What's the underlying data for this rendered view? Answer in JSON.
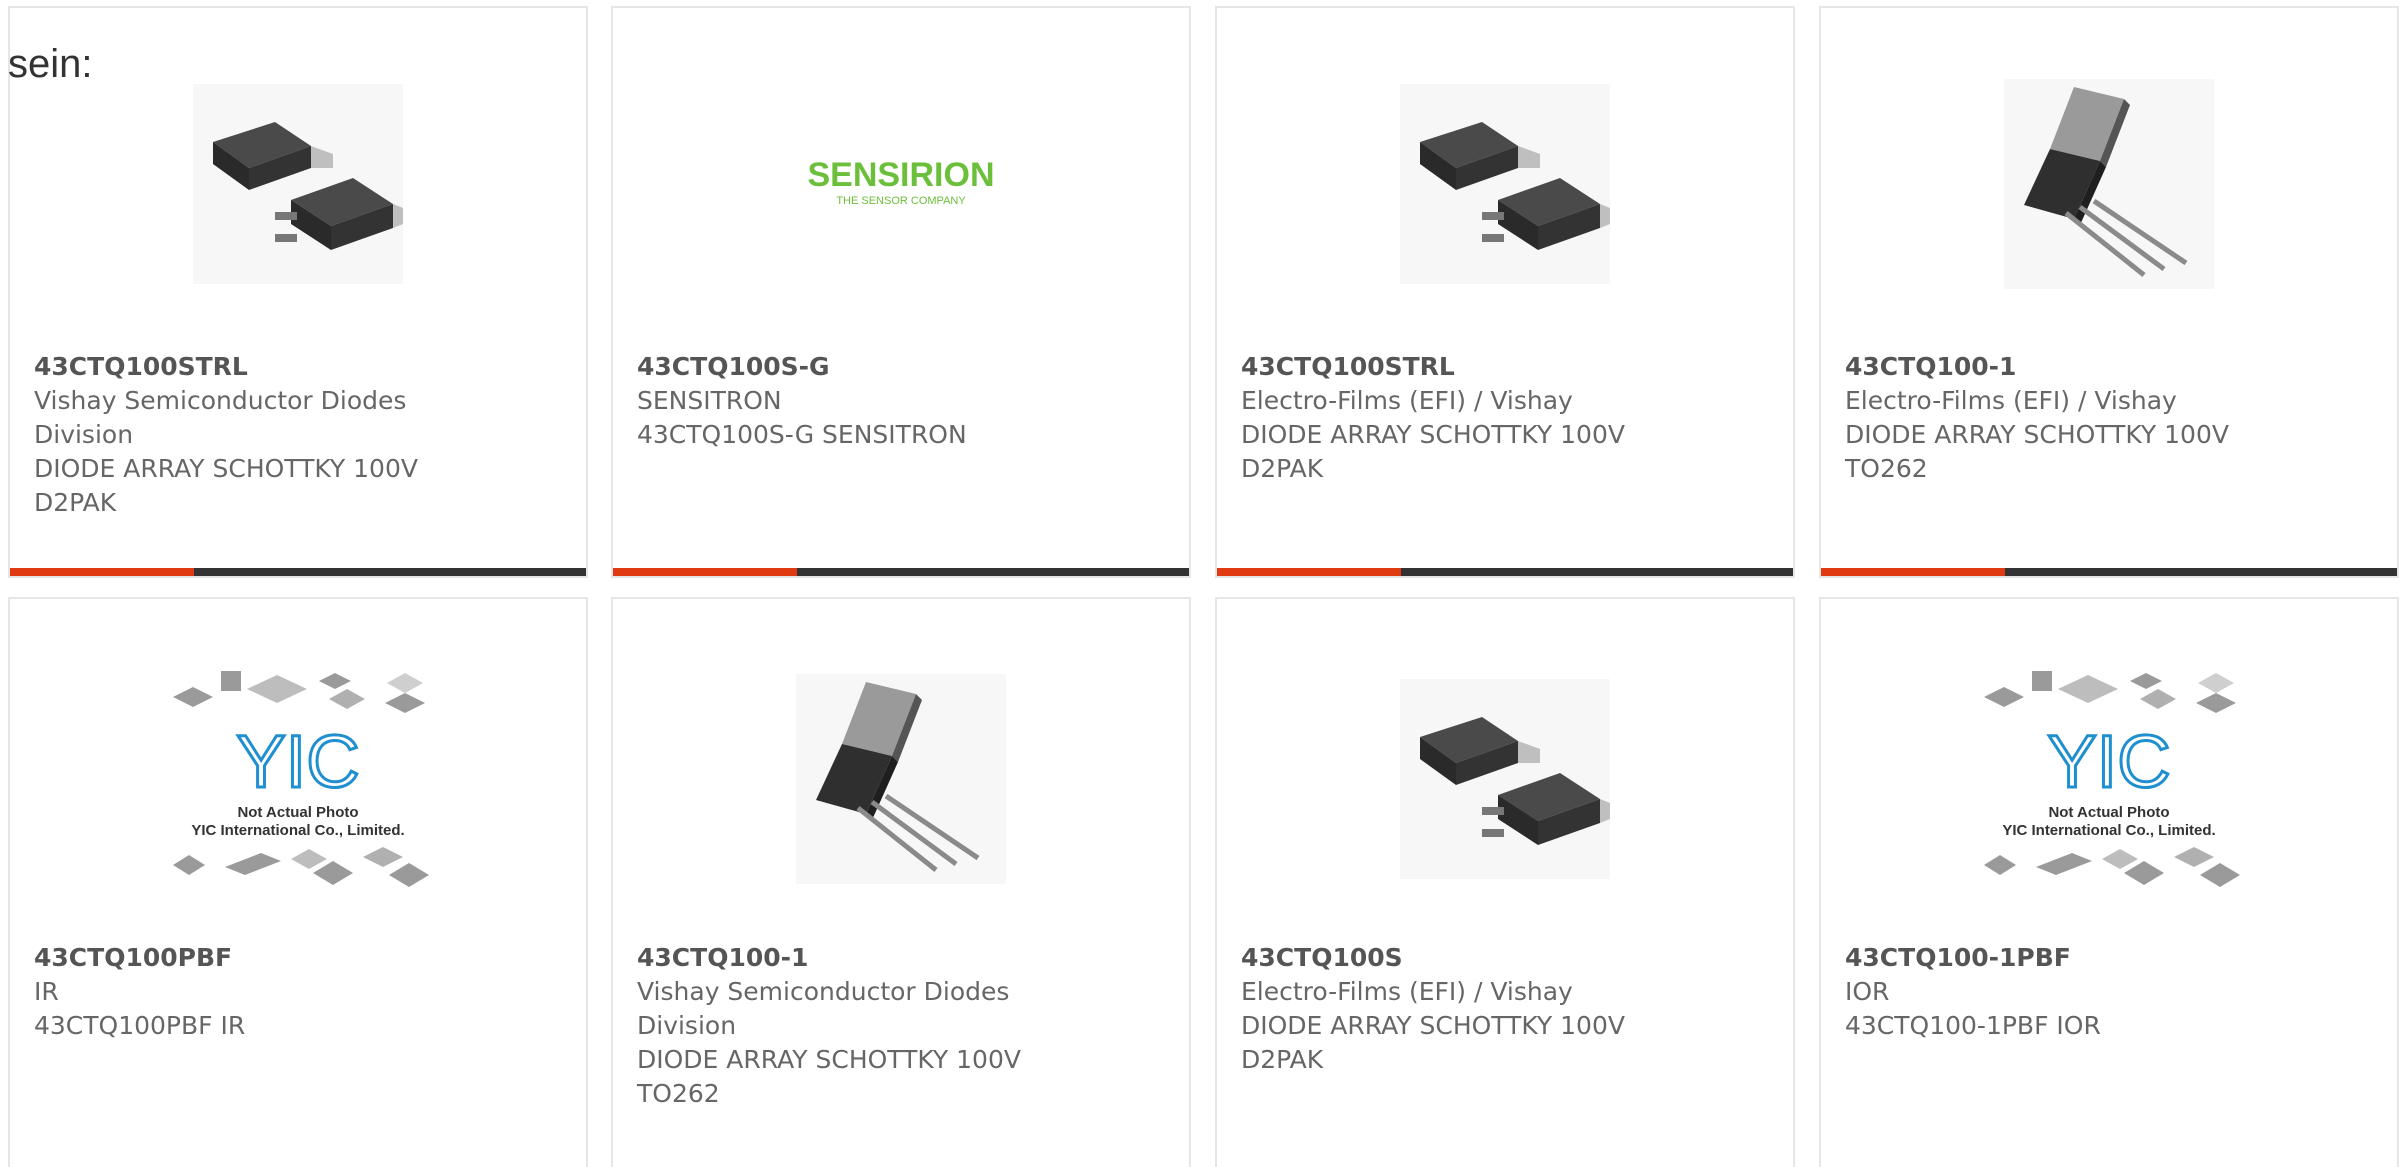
{
  "lead_text": "sein:",
  "cards": [
    {
      "part": "43CTQ100STRL",
      "lines": [
        "Vishay Semiconductor Diodes",
        "Division",
        "DIODE ARRAY SCHOTTKY 100V",
        "D2PAK"
      ],
      "image": "d2pak-package-photo",
      "accent_fraction": 0.32
    },
    {
      "part": "43CTQ100S-G",
      "lines": [
        "SENSITRON",
        "43CTQ100S-G SENSITRON"
      ],
      "image": "sensirion-logo",
      "logo_text": "SENSIRION",
      "logo_tagline": "THE SENSOR COMPANY",
      "accent_fraction": 0.32
    },
    {
      "part": "43CTQ100STRL",
      "lines": [
        "Electro-Films (EFI) / Vishay",
        "DIODE ARRAY SCHOTTKY 100V",
        "D2PAK"
      ],
      "image": "d2pak-package-photo",
      "accent_fraction": 0.32
    },
    {
      "part": "43CTQ100-1",
      "lines": [
        "Electro-Films (EFI) / Vishay",
        "DIODE ARRAY SCHOTTKY 100V",
        "TO262"
      ],
      "image": "to262-package-photo",
      "accent_fraction": 0.32
    },
    {
      "part": "43CTQ100PBF",
      "lines": [
        "IR",
        "43CTQ100PBF IR"
      ],
      "image": "not-actual-photo-placeholder",
      "placeholder_brand": "YIC",
      "placeholder_line1": "Not Actual Photo",
      "placeholder_line2": "YIC International Co., Limited."
    },
    {
      "part": "43CTQ100-1",
      "lines": [
        "Vishay Semiconductor Diodes",
        "Division",
        "DIODE ARRAY SCHOTTKY 100V",
        "TO262"
      ],
      "image": "to262-package-photo"
    },
    {
      "part": "43CTQ100S",
      "lines": [
        "Electro-Films (EFI) / Vishay",
        "DIODE ARRAY SCHOTTKY 100V",
        "D2PAK"
      ],
      "image": "d2pak-package-photo"
    },
    {
      "part": "43CTQ100-1PBF",
      "lines": [
        "IOR",
        "43CTQ100-1PBF IOR"
      ],
      "image": "not-actual-photo-placeholder",
      "placeholder_brand": "YIC",
      "placeholder_line1": "Not Actual Photo",
      "placeholder_line2": "YIC International Co., Limited."
    }
  ],
  "colors": {
    "accent": "#e03a12",
    "bar": "#333333",
    "border": "#e6e6e6",
    "text": "#555555",
    "logo_green": "#6cbf3a",
    "yic_blue": "#1f8fd0"
  }
}
